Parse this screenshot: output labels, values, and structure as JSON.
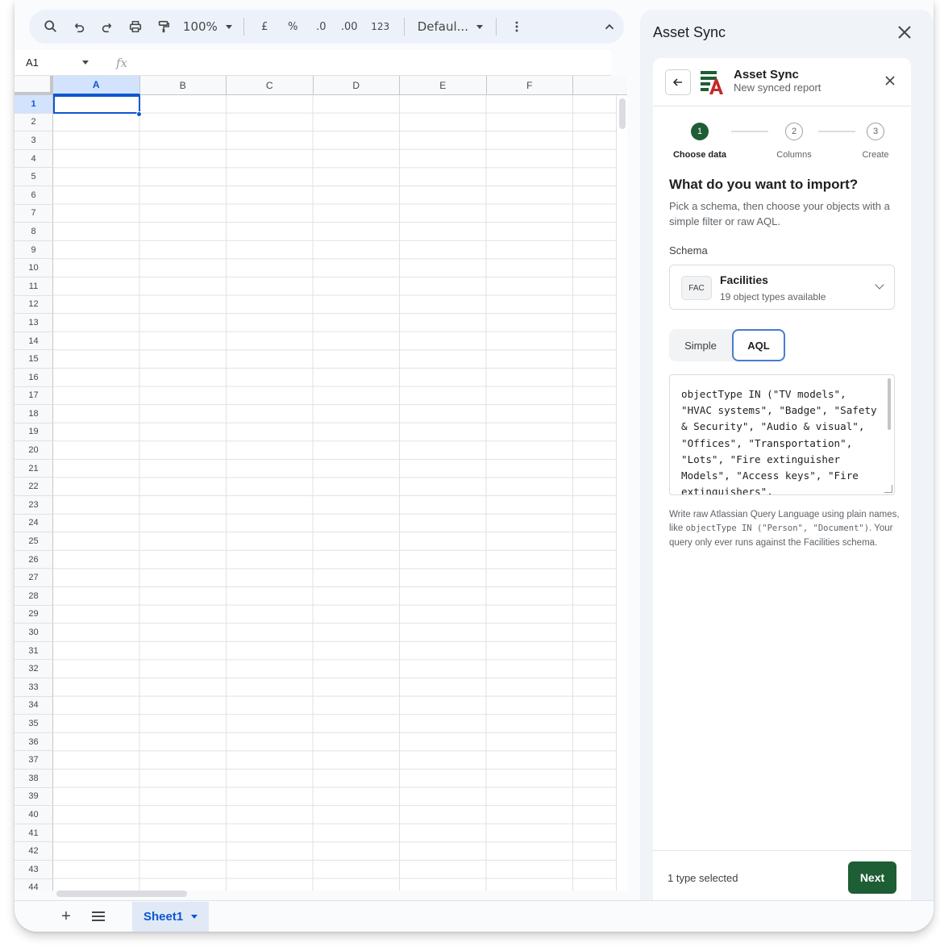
{
  "toolbar": {
    "zoom": "100%",
    "currency": "£",
    "percent": "%",
    "dec_decrease": ".0",
    "dec_increase": ".00",
    "format_number": "123",
    "font": "Defaul..."
  },
  "formula_bar": {
    "cell_ref": "A1",
    "fx": "fx"
  },
  "grid": {
    "columns": [
      "A",
      "B",
      "C",
      "D",
      "E",
      "F",
      ""
    ],
    "rows": [
      "1",
      "2",
      "3",
      "4",
      "5",
      "6",
      "7",
      "8",
      "9",
      "10",
      "11",
      "12",
      "13",
      "14",
      "15",
      "16",
      "17",
      "18",
      "19",
      "20",
      "21",
      "22",
      "23",
      "24",
      "25",
      "26",
      "27",
      "28",
      "29",
      "30",
      "31",
      "32",
      "33",
      "34",
      "35",
      "36",
      "37",
      "38",
      "39",
      "40",
      "41",
      "42",
      "43",
      "44"
    ]
  },
  "sheets": {
    "active": "Sheet1"
  },
  "sidepanel": {
    "title": "Asset Sync",
    "app_name": "Asset Sync",
    "app_subtitle": "New synced report",
    "steps": [
      {
        "num": "1",
        "label": "Choose data"
      },
      {
        "num": "2",
        "label": "Columns"
      },
      {
        "num": "3",
        "label": "Create"
      }
    ],
    "question": "What do you want to import?",
    "description": "Pick a schema, then choose your objects with a simple filter or raw AQL.",
    "schema_label": "Schema",
    "schema": {
      "badge": "FAC",
      "name": "Facilities",
      "subtitle": "19 object types available"
    },
    "mode_toggle": {
      "simple": "Simple",
      "aql": "AQL",
      "selected": "AQL"
    },
    "aql_query": "objectType IN (\"TV models\", \"HVAC systems\", \"Badge\", \"Safety & Security\", \"Audio & visual\", \"Offices\", \"Transportation\", \"Lots\", \"Fire extinguisher Models\", \"Access keys\", \"Fire extinguishers\",",
    "help": {
      "prefix": "Write raw Atlassian Query Language using plain names, like ",
      "example": "objectType IN (\"Person\", \"Document\")",
      "suffix": ". Your query only ever runs against the Facilities schema."
    },
    "footer": {
      "selection": "1 type selected",
      "next": "Next"
    }
  }
}
